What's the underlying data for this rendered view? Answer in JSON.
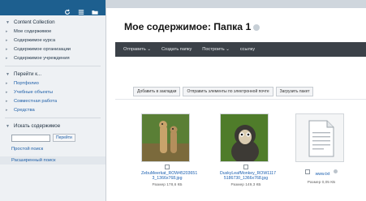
{
  "sidebar": {
    "header": "Content Collection",
    "content_items": [
      "Мое содержимое",
      "Содержимое курса",
      "Содержимое организации",
      "Содержимое учреждения"
    ],
    "goto_header": "Перейти к...",
    "goto_items": [
      "Портфолио",
      "Учебные объекты",
      "Совместная работа",
      "Средства"
    ],
    "search_header": "Искать содержимое",
    "search_button": "Перейти",
    "search_input_value": "",
    "sub_links": [
      "Простой поиск",
      "Расширенный поиск"
    ]
  },
  "main": {
    "title": "Мое содержимое: Папка 1",
    "toolbar": [
      "Отправить",
      "Создать папку",
      "Построить",
      "ссылку"
    ],
    "actions": [
      "Добавить в закладки",
      "Отправить элементы по электронной почте",
      "Загрузить пакет"
    ],
    "files": [
      {
        "name": "ZebuMeerkat_ROW45203651 3_1366x768.jpg",
        "size": "Размер 178,6 КБ",
        "icon": "meerkat-photo-icon"
      },
      {
        "name": "DuskyLeafMonkey_ROW1117 5186730_1366x768.jpg",
        "size": "Размер 149,3 КБ",
        "icon": "monkey-photo-icon"
      },
      {
        "name": "www.txt",
        "size": "Размер 0,05 КБ",
        "icon": "text-document-icon"
      }
    ]
  }
}
